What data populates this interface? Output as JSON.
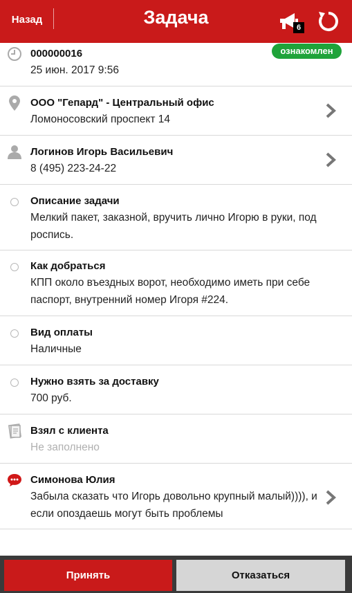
{
  "header": {
    "back_label": "Назад",
    "title": "Задача",
    "notification_count": "6",
    "announce_icon": "megaphone-icon",
    "refresh_icon": "refresh-icon",
    "color": "#c91a1a"
  },
  "task": {
    "number": "000000016",
    "datetime": "25 июн. 2017 9:56",
    "status": "ознакомлен",
    "status_color": "#1fa33a"
  },
  "items": [
    {
      "title": "ООО \"Гепард\" - Центральный офис",
      "text": "Ломоносовский проспект 14",
      "icon": "location-pin-icon"
    },
    {
      "title": "Логинов Игорь Васильевич",
      "text": "8 (495) 223-24-22",
      "icon": "person-icon"
    },
    {
      "title": "Описание задачи",
      "text": "Мелкий пакет, заказной, вручить лично Игорю в руки, под роспись.",
      "icon": "radio-icon"
    },
    {
      "title": "Как добраться",
      "text": "КПП около въездных ворот, необходимо иметь при себе паспорт, внутренний номер Игоря #224.",
      "icon": "radio-icon"
    },
    {
      "title": "Вид оплаты",
      "text": "Наличные",
      "icon": "radio-icon"
    },
    {
      "title": "Нужно взять за доставку",
      "text": "700 руб.",
      "icon": "radio-icon"
    },
    {
      "title": "Взял с клиента",
      "text": "Не заполнено",
      "icon": "notes-icon"
    },
    {
      "title": "Симонова Юлия",
      "text": "Забыла сказать что Игорь довольно крупный малый)))), и если опоздаешь могут быть проблемы",
      "icon": "chat-bubble-icon"
    }
  ],
  "footer": {
    "accept_label": "Принять",
    "decline_label": "Отказаться"
  }
}
